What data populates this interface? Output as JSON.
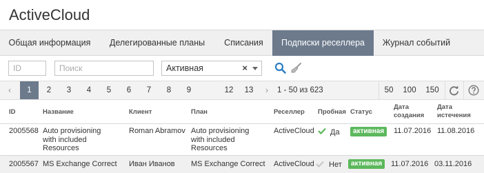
{
  "app": {
    "title": "ActiveCloud"
  },
  "tabs": [
    {
      "label": "Общая информация",
      "active": false
    },
    {
      "label": "Делегированные планы",
      "active": false
    },
    {
      "label": "Списания",
      "active": false
    },
    {
      "label": "Подписки реселлера",
      "active": true
    },
    {
      "label": "Журнал событий",
      "active": false
    }
  ],
  "filters": {
    "id_placeholder": "ID",
    "search_placeholder": "Поиск",
    "status_value": "Активная",
    "status_clear": "×",
    "search_icon": "search-icon",
    "clear_filter_icon": "broom-icon"
  },
  "pagination": {
    "prev": "‹",
    "next": "›",
    "pages": [
      "1",
      "2",
      "3",
      "4",
      "5",
      "6",
      "7",
      "8",
      "9",
      "12",
      "13"
    ],
    "current": "1",
    "info": "1 - 50 из 623",
    "page_sizes": [
      "50",
      "100",
      "150"
    ],
    "refresh_icon": "refresh-icon",
    "help_icon": "help-icon"
  },
  "table": {
    "columns": {
      "id": "ID",
      "name": "Название",
      "client": "Клиент",
      "plan": "План",
      "reseller": "Реселлер",
      "trial": "Пробная",
      "status": "Статус",
      "created_l1": "Дата",
      "created_l2": "создания",
      "expires_l1": "Дата",
      "expires_l2": "истечения"
    },
    "rows": [
      {
        "id": "2005568",
        "name": [
          "Auto provisioning",
          "with included",
          "Resources"
        ],
        "client": "Roman Abramov",
        "plan": [
          "Auto provisioning",
          "with included",
          "Resources"
        ],
        "reseller": "ActiveCloud",
        "trial": "Да",
        "status": "активная",
        "created": "11.07.2016",
        "expires": "11.08.2016"
      },
      {
        "id": "2005567",
        "name": [
          "MS Exchange Correct"
        ],
        "client": "Иван Иванов",
        "plan": [
          "MS Exchange Correct"
        ],
        "reseller": "ActiveCloud",
        "trial": "Нет",
        "status": "активная",
        "created": "11.07.2016",
        "expires": "03.11.2016"
      }
    ]
  },
  "colors": {
    "active_tab": "#6c7a8c",
    "status_badge": "#5cb85c",
    "check_yes": "#5cb85c",
    "check_no": "#c8c8c8",
    "search_icon": "#2e7fc4"
  }
}
